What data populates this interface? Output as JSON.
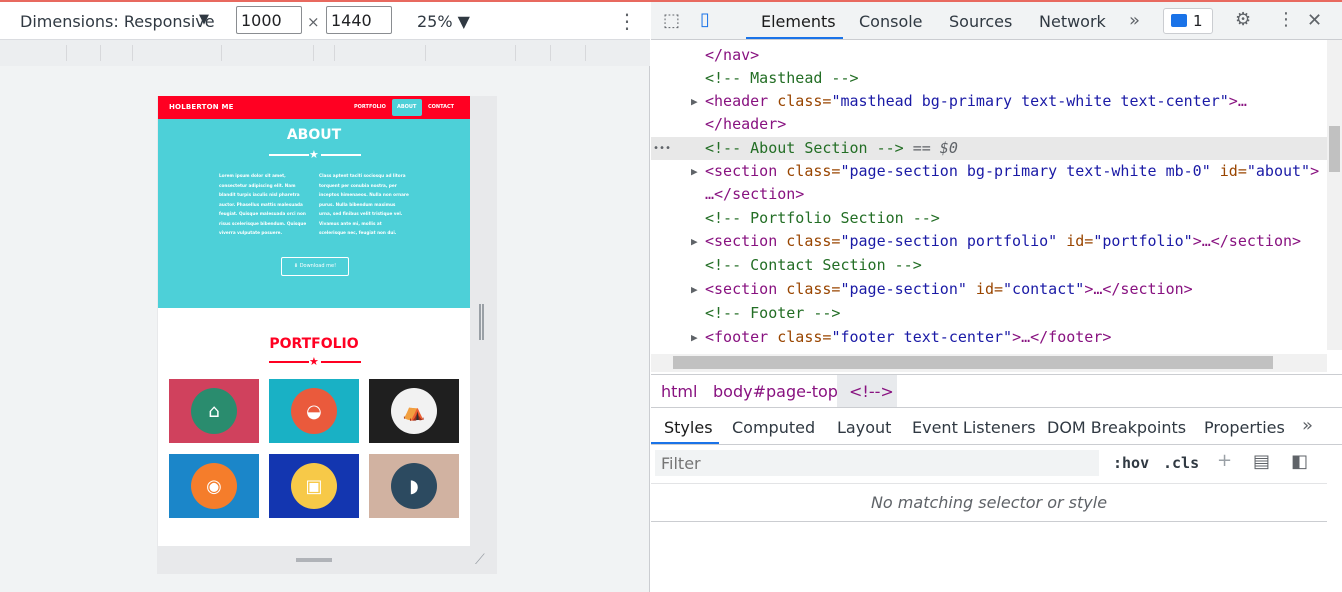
{
  "device_toolbar": {
    "dimensions_label": "Dimensions: Responsive",
    "caret": "▼",
    "width": "1000",
    "times": "×",
    "height": "1440",
    "zoom": "25% ▼",
    "more": "⋮"
  },
  "preview": {
    "brand": "HOLBERTON ME",
    "nav": [
      "PORTFOLIO",
      "ABOUT",
      "CONTACT"
    ],
    "about_title": "ABOUT",
    "about_col1": "Lorem ipsum dolor sit amet, consectetur adipiscing elit. Nam blandit turpis iaculis nisl pharetra auctor. Phasellus mattis malesuada feugiat. Quisque malesuada orci non risus scelerisque bibendum. Quisque viverra vulputate posuere.",
    "about_col2": "Class aptent taciti sociosqu ad litora torquent per conubia nostra, per inceptos himenaeos. Nulla non ornare purus. Nulla bibendum maximus urna, sed finibus velit tristique vel. Vivamus ante mi, mollis at scelerisque nec, feugiat non dui.",
    "download_label": "Download me!",
    "portfolio_title": "PORTFOLIO",
    "tiles": [
      {
        "name": "cabin",
        "bg": "#d0415d",
        "disk": "#2a8c6e",
        "icon": "⌂"
      },
      {
        "name": "cake",
        "bg": "#19b1c5",
        "disk": "#ea5a3c",
        "icon": "◒"
      },
      {
        "name": "circus",
        "bg": "#1f1f1f",
        "disk": "#f2f2f2",
        "icon": "⛺"
      },
      {
        "name": "game",
        "bg": "#1b86c9",
        "disk": "#f57d2b",
        "icon": "◉"
      },
      {
        "name": "safe",
        "bg": "#1336b0",
        "disk": "#f7c948",
        "icon": "▣"
      },
      {
        "name": "submarine",
        "bg": "#d1b2a1",
        "disk": "#2c4a60",
        "icon": "◗"
      }
    ]
  },
  "devtools": {
    "tabs": [
      "Elements",
      "Console",
      "Sources",
      "Network"
    ],
    "overflow": "»",
    "issues_count": "1",
    "settings_icon": "⚙",
    "more": "⋮",
    "close": "✕"
  },
  "dom": {
    "l1": "</nav>",
    "l2": "<!-- Masthead -->",
    "l3_tag": "<header",
    "l3_attr": " class=",
    "l3_val": "\"masthead bg-primary text-white text-center\"",
    "l3_end": ">…",
    "l4": "</header>",
    "l5": "<!-- About Section -->",
    "l5_eq": " == $0",
    "l5_dots": "•••",
    "l6_tag": "<section",
    "l6_attr1": " class=",
    "l6_val1": "\"page-section bg-primary text-white mb-0\"",
    "l6_attr2": " id=",
    "l6_val2": "\"about\"",
    "l6_end": ">",
    "l7": "…</section>",
    "l8": "<!-- Portfolio Section -->",
    "l9_tag": "<section",
    "l9_attr1": " class=",
    "l9_val1": "\"page-section portfolio\"",
    "l9_attr2": " id=",
    "l9_val2": "\"portfolio\"",
    "l9_end": ">…</section>",
    "l10": "<!-- Contact Section -->",
    "l11_tag": "<section",
    "l11_attr1": " class=",
    "l11_val1": "\"page-section\"",
    "l11_attr2": " id=",
    "l11_val2": "\"contact\"",
    "l11_end": ">…</section>",
    "l12": "<!-- Footer -->",
    "l13_tag": "<footer",
    "l13_attr": " class=",
    "l13_val": "\"footer text-center\"",
    "l13_end": ">…</footer>"
  },
  "breadcrumbs": [
    "html",
    "body#page-top",
    "<!-->"
  ],
  "styles": {
    "subtabs": [
      "Styles",
      "Computed",
      "Layout",
      "Event Listeners",
      "DOM Breakpoints",
      "Properties"
    ],
    "overflow": "»",
    "filter_placeholder": "Filter",
    "hov": ":hov",
    "cls": ".cls",
    "plus": "+",
    "empty_message": "No matching selector or style"
  }
}
